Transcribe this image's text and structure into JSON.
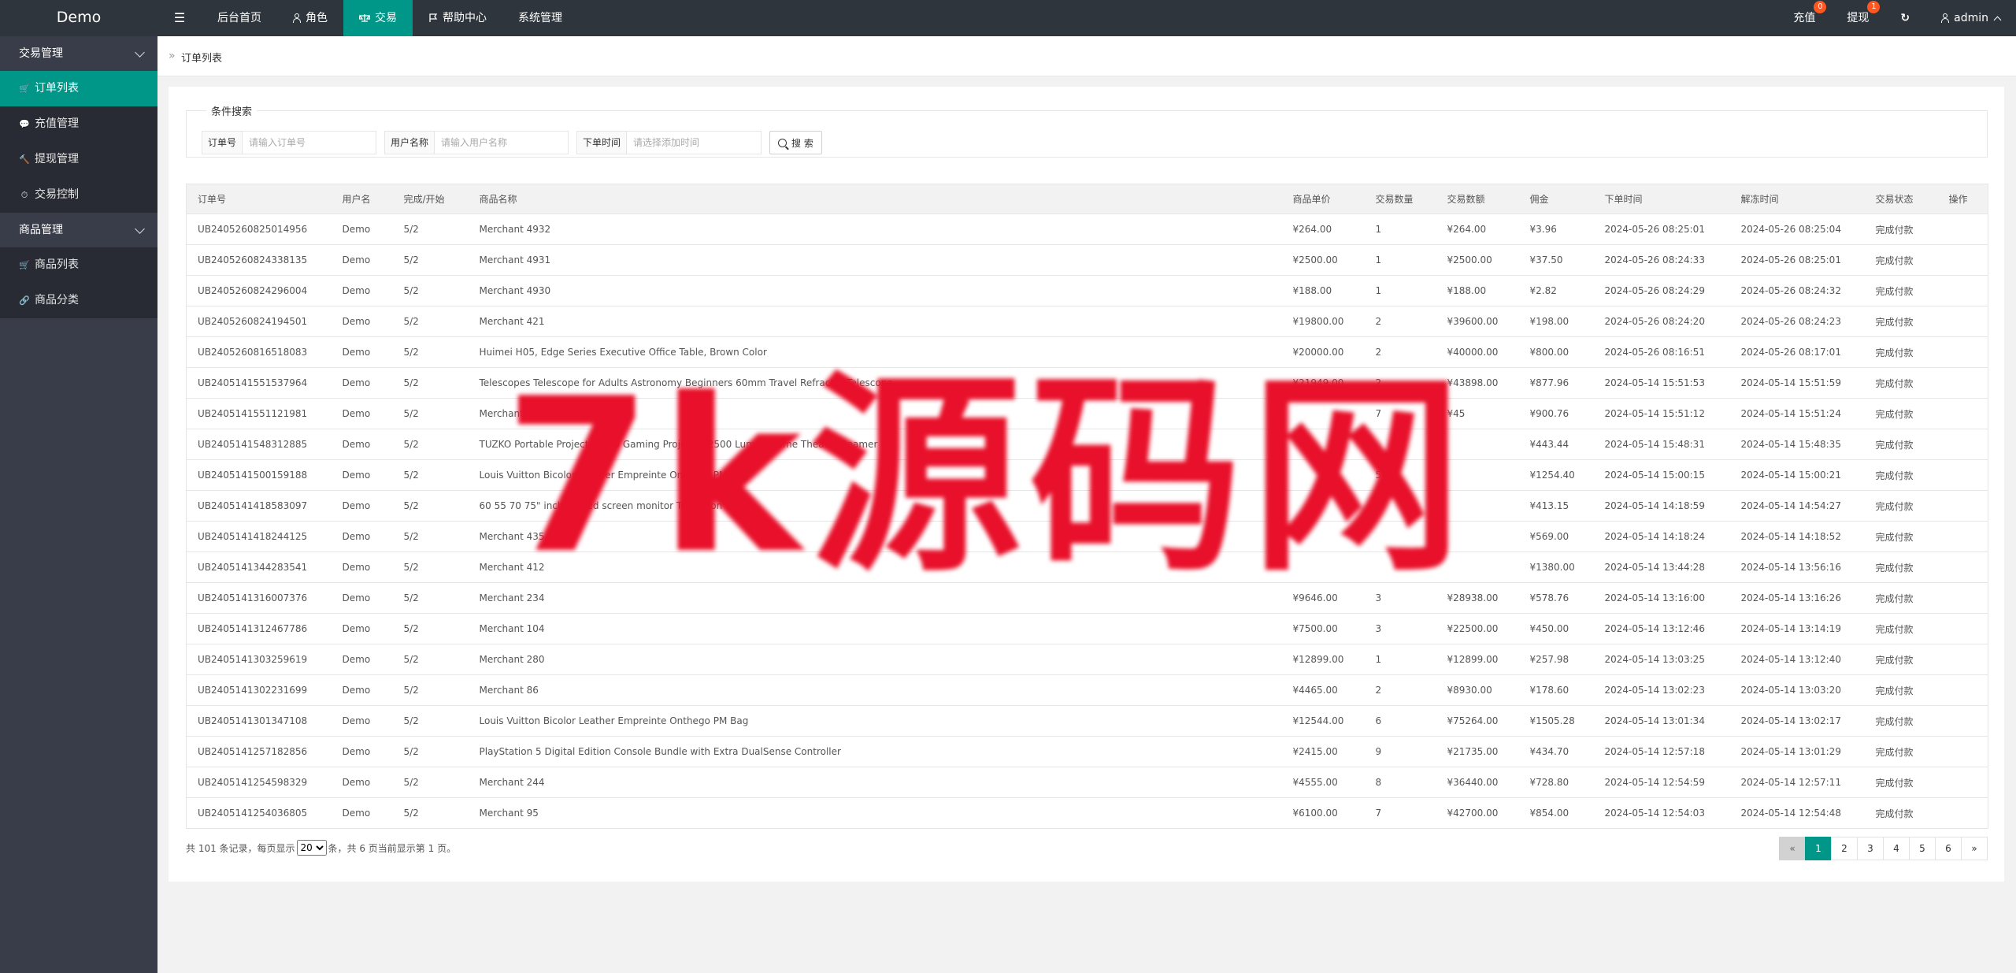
{
  "app": {
    "logo": "Demo"
  },
  "topnav": {
    "menu_toggle": "☰",
    "items": [
      {
        "label": "后台首页",
        "icon": ""
      },
      {
        "label": "角色",
        "icon": "user-icon"
      },
      {
        "label": "交易",
        "icon": "scale-icon",
        "active": true
      },
      {
        "label": "帮助中心",
        "icon": "flag-icon"
      },
      {
        "label": "系统管理",
        "icon": ""
      }
    ]
  },
  "topright": {
    "recharge": {
      "label": "充值",
      "badge": "0"
    },
    "withdraw": {
      "label": "提现",
      "badge": "1"
    },
    "refresh_icon": "↻",
    "user": {
      "label": "admin"
    }
  },
  "sidebar": {
    "groups": [
      {
        "label": "交易管理",
        "items": [
          {
            "label": "订单列表",
            "icon": "🛒",
            "active": true
          },
          {
            "label": "充值管理",
            "icon": "💬"
          },
          {
            "label": "提现管理",
            "icon": "🔨"
          },
          {
            "label": "交易控制",
            "icon": "⏱"
          }
        ]
      },
      {
        "label": "商品管理",
        "items": [
          {
            "label": "商品列表",
            "icon": "🛒"
          },
          {
            "label": "商品分类",
            "icon": "🔗"
          }
        ]
      }
    ]
  },
  "breadcrumb": {
    "arrow": "»",
    "current": "订单列表"
  },
  "search": {
    "legend": "条件搜索",
    "order_no": {
      "label": "订单号",
      "placeholder": "请输入订单号"
    },
    "username": {
      "label": "用户名称",
      "placeholder": "请输入用户名称"
    },
    "order_time": {
      "label": "下单时间",
      "placeholder": "请选择添加时间"
    },
    "button": "搜 索"
  },
  "table": {
    "headers": [
      "订单号",
      "用户名",
      "完成/开始",
      "商品名称",
      "商品单价",
      "交易数量",
      "交易数额",
      "佣金",
      "下单时间",
      "解冻时间",
      "交易状态",
      "操作"
    ],
    "rows": [
      [
        "UB2405260825014956",
        "Demo",
        "5/2",
        "Merchant 4932",
        "¥264.00",
        "1",
        "¥264.00",
        "¥3.96",
        "2024-05-26 08:25:01",
        "2024-05-26 08:25:04",
        "完成付款",
        ""
      ],
      [
        "UB2405260824338135",
        "Demo",
        "5/2",
        "Merchant 4931",
        "¥2500.00",
        "1",
        "¥2500.00",
        "¥37.50",
        "2024-05-26 08:24:33",
        "2024-05-26 08:25:01",
        "完成付款",
        ""
      ],
      [
        "UB2405260824296004",
        "Demo",
        "5/2",
        "Merchant 4930",
        "¥188.00",
        "1",
        "¥188.00",
        "¥2.82",
        "2024-05-26 08:24:29",
        "2024-05-26 08:24:32",
        "完成付款",
        ""
      ],
      [
        "UB2405260824194501",
        "Demo",
        "5/2",
        "Merchant 421",
        "¥19800.00",
        "2",
        "¥39600.00",
        "¥198.00",
        "2024-05-26 08:24:20",
        "2024-05-26 08:24:23",
        "完成付款",
        ""
      ],
      [
        "UB2405260816518083",
        "Demo",
        "5/2",
        "Huimei H05, Edge Series Executive Office Table, Brown Color",
        "¥20000.00",
        "2",
        "¥40000.00",
        "¥800.00",
        "2024-05-26 08:16:51",
        "2024-05-26 08:17:01",
        "完成付款",
        ""
      ],
      [
        "UB2405141551537964",
        "Demo",
        "5/2",
        "Telescopes Telescope for Adults Astronomy Beginners 60mm Travel Refractor Telescope",
        "¥21949.00",
        "2",
        "¥43898.00",
        "¥877.96",
        "2024-05-14 15:51:53",
        "2024-05-14 15:51:59",
        "完成付款",
        ""
      ],
      [
        "UB2405141551121981",
        "Demo",
        "5/2",
        "Merchant",
        "",
        "7",
        "¥45",
        "¥900.76",
        "2024-05-14 15:51:12",
        "2024-05-14 15:51:24",
        "完成付款",
        ""
      ],
      [
        "UB2405141548312885",
        "Demo",
        "5/2",
        "TUZKO Portable Projector LED Gaming Projector 2500 Lumen Home Theater Beamer",
        "",
        "",
        "",
        "¥443.44",
        "2024-05-14 15:48:31",
        "2024-05-14 15:48:35",
        "完成付款",
        ""
      ],
      [
        "UB2405141500159188",
        "Demo",
        "5/2",
        "Louis Vuitton Bicolor Leather Empreinte Onthego PM Bag",
        "",
        "5",
        "",
        "¥1254.40",
        "2024-05-14 15:00:15",
        "2024-05-14 15:00:21",
        "完成付款",
        ""
      ],
      [
        "UB2405141418583097",
        "Demo",
        "5/2",
        "60 55 70 75\" inch curved screen monitor Television TV",
        "",
        "",
        "",
        "¥413.15",
        "2024-05-14 14:18:59",
        "2024-05-14 14:54:27",
        "完成付款",
        ""
      ],
      [
        "UB2405141418244125",
        "Demo",
        "5/2",
        "Merchant 435",
        "",
        "",
        "",
        "¥569.00",
        "2024-05-14 14:18:24",
        "2024-05-14 14:18:52",
        "完成付款",
        ""
      ],
      [
        "UB2405141344283541",
        "Demo",
        "5/2",
        "Merchant 412",
        "",
        "",
        "",
        "¥1380.00",
        "2024-05-14 13:44:28",
        "2024-05-14 13:56:16",
        "完成付款",
        ""
      ],
      [
        "UB2405141316007376",
        "Demo",
        "5/2",
        "Merchant 234",
        "¥9646.00",
        "3",
        "¥28938.00",
        "¥578.76",
        "2024-05-14 13:16:00",
        "2024-05-14 13:16:26",
        "完成付款",
        ""
      ],
      [
        "UB2405141312467786",
        "Demo",
        "5/2",
        "Merchant 104",
        "¥7500.00",
        "3",
        "¥22500.00",
        "¥450.00",
        "2024-05-14 13:12:46",
        "2024-05-14 13:14:19",
        "完成付款",
        ""
      ],
      [
        "UB2405141303259619",
        "Demo",
        "5/2",
        "Merchant 280",
        "¥12899.00",
        "1",
        "¥12899.00",
        "¥257.98",
        "2024-05-14 13:03:25",
        "2024-05-14 13:12:40",
        "完成付款",
        ""
      ],
      [
        "UB2405141302231699",
        "Demo",
        "5/2",
        "Merchant 86",
        "¥4465.00",
        "2",
        "¥8930.00",
        "¥178.60",
        "2024-05-14 13:02:23",
        "2024-05-14 13:03:20",
        "完成付款",
        ""
      ],
      [
        "UB2405141301347108",
        "Demo",
        "5/2",
        "Louis Vuitton Bicolor Leather Empreinte Onthego PM Bag",
        "¥12544.00",
        "6",
        "¥75264.00",
        "¥1505.28",
        "2024-05-14 13:01:34",
        "2024-05-14 13:02:17",
        "完成付款",
        ""
      ],
      [
        "UB2405141257182856",
        "Demo",
        "5/2",
        "PlayStation 5 Digital Edition Console Bundle with Extra DualSense Controller",
        "¥2415.00",
        "9",
        "¥21735.00",
        "¥434.70",
        "2024-05-14 12:57:18",
        "2024-05-14 13:01:29",
        "完成付款",
        ""
      ],
      [
        "UB2405141254598329",
        "Demo",
        "5/2",
        "Merchant 244",
        "¥4555.00",
        "8",
        "¥36440.00",
        "¥728.80",
        "2024-05-14 12:54:59",
        "2024-05-14 12:57:11",
        "完成付款",
        ""
      ],
      [
        "UB2405141254036805",
        "Demo",
        "5/2",
        "Merchant 95",
        "¥6100.00",
        "7",
        "¥42700.00",
        "¥854.00",
        "2024-05-14 12:54:03",
        "2024-05-14 12:54:48",
        "完成付款",
        ""
      ]
    ]
  },
  "footer": {
    "prefix": "共 101 条记录，每页显示",
    "page_size": "20",
    "suffix": "条，共 6 页当前显示第 1 页。"
  },
  "pager": {
    "prev": "«",
    "pages": [
      "1",
      "2",
      "3",
      "4",
      "5",
      "6"
    ],
    "current": "1",
    "next": "»"
  },
  "watermark": "7k源码网",
  "colors": {
    "accent": "#009688",
    "header": "#2f353c",
    "sidebar": "#393d49",
    "badge": "#ff5722",
    "watermark": "#e8102a"
  }
}
